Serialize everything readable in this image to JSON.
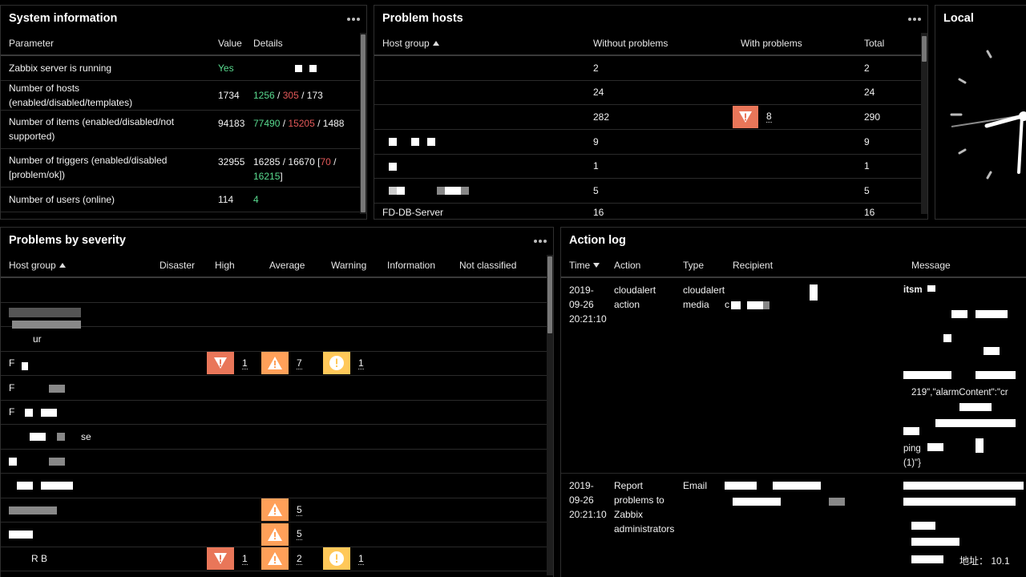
{
  "system_info": {
    "title": "System information",
    "columns": [
      "Parameter",
      "Value",
      "Details"
    ],
    "rows": [
      {
        "param": "Zabbix server is running",
        "value": "Yes"
      },
      {
        "param": "Number of hosts (enabled/disabled/templates)",
        "value": "1734",
        "d1": "1256",
        "d2": "305",
        "d3": "173"
      },
      {
        "param": "Number of items (enabled/disabled/not supported)",
        "value": "94183",
        "d1": "77490",
        "d2": "15205",
        "d3": "1488"
      },
      {
        "param": "Number of triggers (enabled/disabled [problem/ok])",
        "value": "32955",
        "d1": "16285",
        "d2": "16670",
        "d3": "70",
        "d4": "16215"
      },
      {
        "param": "Number of users (online)",
        "value": "114",
        "d1": "4"
      }
    ]
  },
  "problem_hosts": {
    "title": "Problem hosts",
    "columns": [
      "Host group",
      "Without problems",
      "With problems",
      "Total"
    ],
    "rows": [
      {
        "without": "2",
        "with": "",
        "total": "2"
      },
      {
        "without": "24",
        "with": "",
        "total": "24"
      },
      {
        "without": "282",
        "with": "8",
        "total": "290"
      },
      {
        "without": "9",
        "with": "",
        "total": "9"
      },
      {
        "without": "1",
        "with": "",
        "total": "1"
      },
      {
        "without": "5",
        "with": "",
        "total": "5"
      },
      {
        "group": "FD-DB-Server",
        "without": "16",
        "with": "",
        "total": "16"
      }
    ]
  },
  "local_clock": {
    "title": "Local"
  },
  "problems_by_severity": {
    "title": "Problems by severity",
    "columns": [
      "Host group",
      "Disaster",
      "High",
      "Average",
      "Warning",
      "Information",
      "Not classified"
    ],
    "rows": [
      {
        "label": "",
        "high": "",
        "average": "",
        "warning": ""
      },
      {
        "label": "e",
        "high": "",
        "average": "",
        "warning": ""
      },
      {
        "label": "ur",
        "high": "",
        "average": "",
        "warning": ""
      },
      {
        "label": "F",
        "high": "1",
        "average": "7",
        "warning": "1"
      },
      {
        "label": "F",
        "high": "",
        "average": "",
        "warning": ""
      },
      {
        "label": "F",
        "high": "",
        "average": "",
        "warning": ""
      },
      {
        "label": "se",
        "high": "",
        "average": "",
        "warning": ""
      },
      {
        "label": "",
        "high": "",
        "average": "",
        "warning": ""
      },
      {
        "label": "",
        "high": "",
        "average": "",
        "warning": ""
      },
      {
        "label": "",
        "high": "",
        "average": "5",
        "warning": ""
      },
      {
        "label": "",
        "high": "",
        "average": "5",
        "warning": ""
      },
      {
        "label": "R B",
        "high": "1",
        "average": "2",
        "warning": "1"
      }
    ]
  },
  "action_log": {
    "title": "Action log",
    "columns": [
      "Time",
      "Action",
      "Type",
      "Recipient",
      "Message"
    ],
    "rows": [
      {
        "time": "2019-09-26 20:21:10",
        "action": "cloudalert action",
        "type": "cloudalert media",
        "recipient": "c",
        "msg_head": "itsm",
        "msg_mid": "219\",\"alarmContent\":\"cr",
        "msg_tail": "ping",
        "msg_tail2": "(1)\"}"
      },
      {
        "time": "2019-09-26 20:21:10",
        "action": "Report problems to Zabbix administrators",
        "type": "Email",
        "recipient": "",
        "msg_tail": "地址： 10.1"
      }
    ]
  },
  "colors": {
    "high": "#e97659",
    "average": "#ffa059",
    "warning": "#ffc859",
    "ok": "#59db8f",
    "problem": "#e45959"
  }
}
